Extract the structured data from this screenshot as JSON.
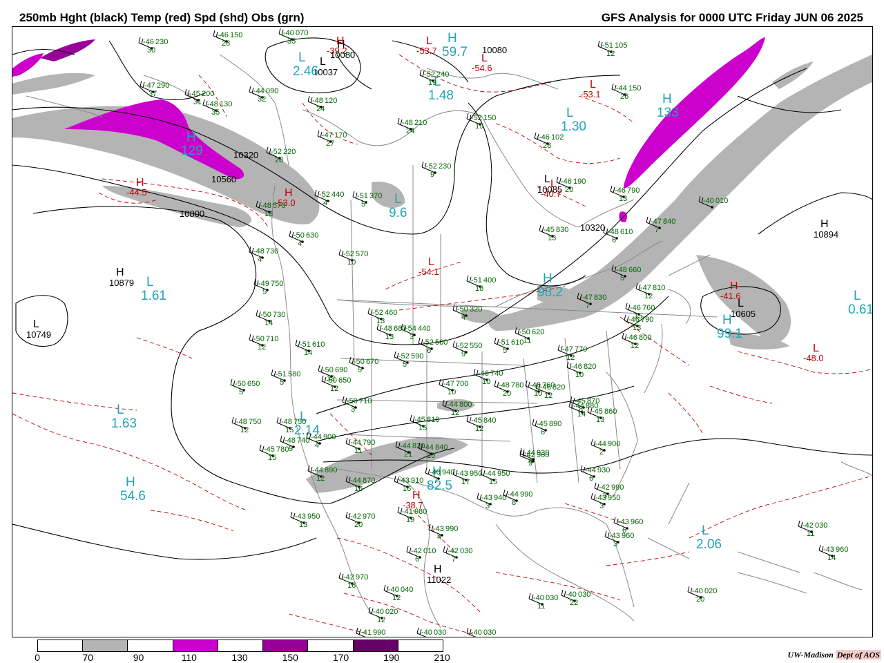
{
  "header": {
    "title_left": "250mb Hght (black) Temp (red) Spd (shd) Obs (grn)",
    "title_right": "GFS Analysis for 0000 UTC Friday  JUN 06 2025"
  },
  "colors": {
    "height_contour": "#000000",
    "temperature_contour": "#c00000",
    "observations": "#006400",
    "highs_lows_speed": "#1fa5b5",
    "borders": "#888888"
  },
  "height_centers": [
    {
      "type": "H",
      "value": "10879"
    },
    {
      "type": "L",
      "value": "10749"
    },
    {
      "type": "H",
      "value": "11022"
    },
    {
      "type": "H",
      "value": "10894"
    },
    {
      "type": "L",
      "value": "10605"
    },
    {
      "type": "L",
      "value": "10085"
    },
    {
      "type": "L",
      "value": "10037"
    },
    {
      "type": "H",
      "value": "10080"
    }
  ],
  "height_labels": [
    "10800",
    "10560",
    "10320",
    "10320",
    "10080",
    "10800"
  ],
  "speed_centers": [
    {
      "type": "L",
      "value": "1.61"
    },
    {
      "type": "L",
      "value": "1.63"
    },
    {
      "type": "H",
      "value": "54.6"
    },
    {
      "type": "L",
      "value": "2.06"
    },
    {
      "type": "L",
      "value": "0.61"
    },
    {
      "type": "H",
      "value": "99.1"
    },
    {
      "type": "H",
      "value": "98.2"
    },
    {
      "type": "H",
      "value": "82.5"
    },
    {
      "type": "L",
      "value": "2.46"
    },
    {
      "type": "L",
      "value": "1.48"
    },
    {
      "type": "L",
      "value": "1.30"
    },
    {
      "type": "H",
      "value": "129"
    },
    {
      "type": "H",
      "value": "133"
    },
    {
      "type": "L",
      "value": "2.14"
    },
    {
      "type": "L",
      "value": "9.6"
    },
    {
      "type": "H",
      "value": "59.7"
    }
  ],
  "temp_centers": [
    {
      "type": "H",
      "value": "-44.5"
    },
    {
      "type": "H",
      "value": "-38.7"
    },
    {
      "type": "L",
      "value": "-48.0"
    },
    {
      "type": "H",
      "value": "-41.6"
    },
    {
      "type": "L",
      "value": "-40.7"
    },
    {
      "type": "H",
      "value": "-39.2"
    },
    {
      "type": "L",
      "value": "-54.1"
    },
    {
      "type": "L",
      "value": "-53.1"
    },
    {
      "type": "H",
      "value": "-53.0"
    },
    {
      "type": "L",
      "value": "-54.6"
    },
    {
      "type": "L",
      "value": "-53.7"
    }
  ],
  "observations": [
    {
      "t": "-46",
      "h": "230",
      "d": "30"
    },
    {
      "t": "-46",
      "h": "150",
      "d": "28"
    },
    {
      "t": "-40",
      "h": "070",
      "d": "35"
    },
    {
      "t": "-47",
      "h": "290",
      "d": "37"
    },
    {
      "t": "-45",
      "h": "200",
      "d": "31"
    },
    {
      "t": "-44",
      "h": "090",
      "d": "32"
    },
    {
      "t": "-48",
      "h": "130",
      "d": "35"
    },
    {
      "t": "-48",
      "h": "120",
      "d": "24"
    },
    {
      "t": "-52",
      "h": "240",
      "d": "19"
    },
    {
      "t": "-48",
      "h": "210",
      "d": "24"
    },
    {
      "t": "-52",
      "h": "150",
      "d": "19"
    },
    {
      "t": "-47",
      "h": "170",
      "d": "27"
    },
    {
      "t": "-52",
      "h": "220",
      "d": "28"
    },
    {
      "t": "-52",
      "h": "230",
      "d": "9"
    },
    {
      "t": "-46",
      "h": "102",
      "d": "28"
    },
    {
      "t": "-46",
      "h": "190",
      "d": "20"
    },
    {
      "t": "-51",
      "h": "105",
      "d": "12"
    },
    {
      "t": "-44",
      "h": "150",
      "d": "26"
    },
    {
      "t": "-52",
      "h": "440",
      "d": "4"
    },
    {
      "t": "-51",
      "h": "370",
      "d": "5"
    },
    {
      "t": "-48",
      "h": "570",
      "d": "18"
    },
    {
      "t": "-50",
      "h": "630",
      "d": "4"
    },
    {
      "t": "-52",
      "h": "570",
      "d": "10"
    },
    {
      "t": "-48",
      "h": "730",
      "d": "4"
    },
    {
      "t": "-49",
      "h": "750",
      "d": "5"
    },
    {
      "t": "-50",
      "h": "730",
      "d": "14"
    },
    {
      "t": "-50",
      "h": "710",
      "d": "12"
    },
    {
      "t": "-51",
      "h": "610",
      "d": "14"
    },
    {
      "t": "-52",
      "h": "460",
      "d": "13"
    },
    {
      "t": "-51",
      "h": "400",
      "d": "18"
    },
    {
      "t": "-50",
      "h": "320",
      "d": "4"
    },
    {
      "t": "-54",
      "h": "440",
      "d": "3"
    },
    {
      "t": "-52",
      "h": "500",
      "d": "6"
    },
    {
      "t": "-52",
      "h": "550",
      "d": "9"
    },
    {
      "t": "-51",
      "h": "610",
      "d": "5"
    },
    {
      "t": "-50",
      "h": "620",
      "d": "11"
    },
    {
      "t": "-50",
      "h": "670",
      "d": "5"
    },
    {
      "t": "-52",
      "h": "590",
      "d": "5"
    },
    {
      "t": "-51",
      "h": "580",
      "d": "5"
    },
    {
      "t": "-50",
      "h": "690",
      "d": "12"
    },
    {
      "t": "-50",
      "h": "650",
      "d": "12"
    },
    {
      "t": "-50",
      "h": "650",
      "d": "5"
    },
    {
      "t": "-48",
      "h": "750",
      "d": "12"
    },
    {
      "t": "-48",
      "h": "750",
      "d": "15"
    },
    {
      "t": "-48",
      "h": "740",
      "d": "9"
    },
    {
      "t": "-50",
      "h": "710",
      "d": "3"
    },
    {
      "t": "-47",
      "h": "700",
      "d": "10"
    },
    {
      "t": "-46",
      "h": "740",
      "d": "10"
    },
    {
      "t": "-48",
      "h": "780",
      "d": "20"
    },
    {
      "t": "-48",
      "h": "760",
      "d": "10"
    },
    {
      "t": "-47",
      "h": "770",
      "d": "12"
    },
    {
      "t": "-46",
      "h": "820",
      "d": "10"
    },
    {
      "t": "-46",
      "h": "820",
      "d": "12"
    },
    {
      "t": "-44",
      "h": "800",
      "d": "12"
    },
    {
      "t": "-45",
      "h": "810",
      "d": "15"
    },
    {
      "t": "-45",
      "h": "840",
      "d": "12"
    },
    {
      "t": "-45",
      "h": "890",
      "d": "6"
    },
    {
      "t": "-45",
      "h": "870",
      "d": "8"
    },
    {
      "t": "-44",
      "h": "880",
      "d": "14"
    },
    {
      "t": "-45",
      "h": "860",
      "d": "13"
    },
    {
      "t": "-44",
      "h": "900",
      "d": "2"
    },
    {
      "t": "-44",
      "h": "900",
      "d": "4"
    },
    {
      "t": "-45",
      "h": "780",
      "d": "15"
    },
    {
      "t": "-44",
      "h": "790",
      "d": "11"
    },
    {
      "t": "-44",
      "h": "830",
      "d": "21"
    },
    {
      "t": "-44",
      "h": "840",
      "d": "16"
    },
    {
      "t": "-44",
      "h": "890",
      "d": "12"
    },
    {
      "t": "-44",
      "h": "870",
      "d": "16"
    },
    {
      "t": "-43",
      "h": "910",
      "d": "16"
    },
    {
      "t": "-40",
      "h": "940",
      "d": "7"
    },
    {
      "t": "-43",
      "h": "950",
      "d": "17"
    },
    {
      "t": "-44",
      "h": "950",
      "d": "15"
    },
    {
      "t": "-42",
      "h": "960",
      "d": "9"
    },
    {
      "t": "-44",
      "h": "930",
      "d": "4"
    },
    {
      "t": "-44",
      "h": "930",
      "d": "6"
    },
    {
      "t": "-43",
      "h": "940",
      "d": "3"
    },
    {
      "t": "-44",
      "h": "990",
      "d": "8"
    },
    {
      "t": "-42",
      "h": "990",
      "d": "3"
    },
    {
      "t": "-43",
      "h": "950",
      "d": "3"
    },
    {
      "t": "-43",
      "h": "960",
      "d": "6"
    },
    {
      "t": "-43",
      "h": "960",
      "d": "3"
    },
    {
      "t": "-43",
      "h": "950",
      "d": "13"
    },
    {
      "t": "-42",
      "h": "970",
      "d": "20"
    },
    {
      "t": "-41",
      "h": "980",
      "d": "19"
    },
    {
      "t": "-43",
      "h": "990",
      "d": "4"
    },
    {
      "t": "-42",
      "h": "010",
      "d": "6"
    },
    {
      "t": "-42",
      "h": "030",
      "d": "7"
    },
    {
      "t": "-42",
      "h": "030",
      "d": "11"
    },
    {
      "t": "-43",
      "h": "960",
      "d": "14"
    },
    {
      "t": "-42",
      "h": "970",
      "d": "16"
    },
    {
      "t": "-40",
      "h": "040",
      "d": "12"
    },
    {
      "t": "-40",
      "h": "020",
      "d": "12"
    },
    {
      "t": "-40",
      "h": "030",
      "d": "11"
    },
    {
      "t": "-40",
      "h": "030",
      "d": "22"
    },
    {
      "t": "-40",
      "h": "020",
      "d": "20"
    },
    {
      "t": "-41",
      "h": "990",
      "d": "16"
    },
    {
      "t": "-40",
      "h": "030",
      "d": ""
    },
    {
      "t": "-40",
      "h": "030",
      "d": ""
    },
    {
      "t": "-40",
      "h": "010",
      "d": ""
    },
    {
      "t": "-47",
      "h": "840",
      "d": "7"
    },
    {
      "t": "-46",
      "h": "790",
      "d": "13"
    },
    {
      "t": "-48",
      "h": "610",
      "d": "6"
    },
    {
      "t": "-48",
      "h": "660",
      "d": "5"
    },
    {
      "t": "-47",
      "h": "810",
      "d": "12"
    },
    {
      "t": "-46",
      "h": "760",
      "d": "15"
    },
    {
      "t": "-46",
      "h": "790",
      "d": "13"
    },
    {
      "t": "-46",
      "h": "800",
      "d": "12"
    },
    {
      "t": "-45",
      "h": "830",
      "d": "13"
    },
    {
      "t": "-47",
      "h": "830",
      "d": "7"
    },
    {
      "t": "-48",
      "h": "680",
      "d": "13"
    }
  ],
  "legend": {
    "ticks": [
      "0",
      "70",
      "90",
      "110",
      "130",
      "150",
      "170",
      "190",
      "210"
    ],
    "colors": [
      "#ffffff",
      "#b4b4b4",
      "#ffffff",
      "#cc00cc",
      "#ffffff",
      "#990099",
      "#ffffff",
      "#660066",
      "#ffffff"
    ]
  },
  "credit": {
    "institution": "UW-Madison",
    "dept": "Dept of AOS"
  }
}
